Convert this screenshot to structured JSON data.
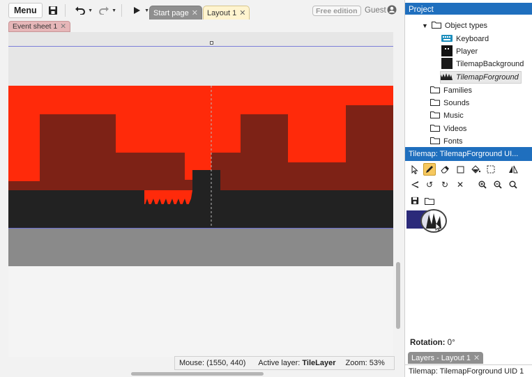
{
  "toolbar": {
    "menu_label": "Menu",
    "free_edition": "Free edition",
    "user": "Guest"
  },
  "tabs": [
    {
      "label": "Start page",
      "state": "inactive"
    },
    {
      "label": "Layout 1",
      "state": "active"
    }
  ],
  "event_sheet_tab": "Event sheet 1",
  "status": {
    "mouse": "Mouse: (1550, 440)",
    "active_layer_label": "Active layer:",
    "active_layer": "TileLayer",
    "zoom": "Zoom: 53%"
  },
  "project": {
    "title": "Project",
    "items": [
      {
        "label": "Object types",
        "kind": "folder-open"
      },
      {
        "label": "Keyboard",
        "kind": "keyboard"
      },
      {
        "label": "Player",
        "kind": "sprite"
      },
      {
        "label": "TilemapBackground",
        "kind": "tilemap"
      },
      {
        "label": "TilemapForground",
        "kind": "tilemap-selected"
      },
      {
        "label": "Families",
        "kind": "folder"
      },
      {
        "label": "Sounds",
        "kind": "folder"
      },
      {
        "label": "Music",
        "kind": "folder"
      },
      {
        "label": "Videos",
        "kind": "folder"
      },
      {
        "label": "Fonts",
        "kind": "folder"
      }
    ]
  },
  "tilemap_panel": {
    "title": "Tilemap: TilemapForground UI..."
  },
  "rotation": {
    "label": "Rotation:",
    "value": "0°"
  },
  "layers_tab": "Layers - Layout 1",
  "bottom_status": "Tilemap: TilemapForground UID 1",
  "colors": {
    "sky": "#ff2a0a",
    "buildings": "#7d2216",
    "ground": "#222222",
    "panel_header": "#1f6fbe",
    "active_tab": "#fff4cf"
  }
}
